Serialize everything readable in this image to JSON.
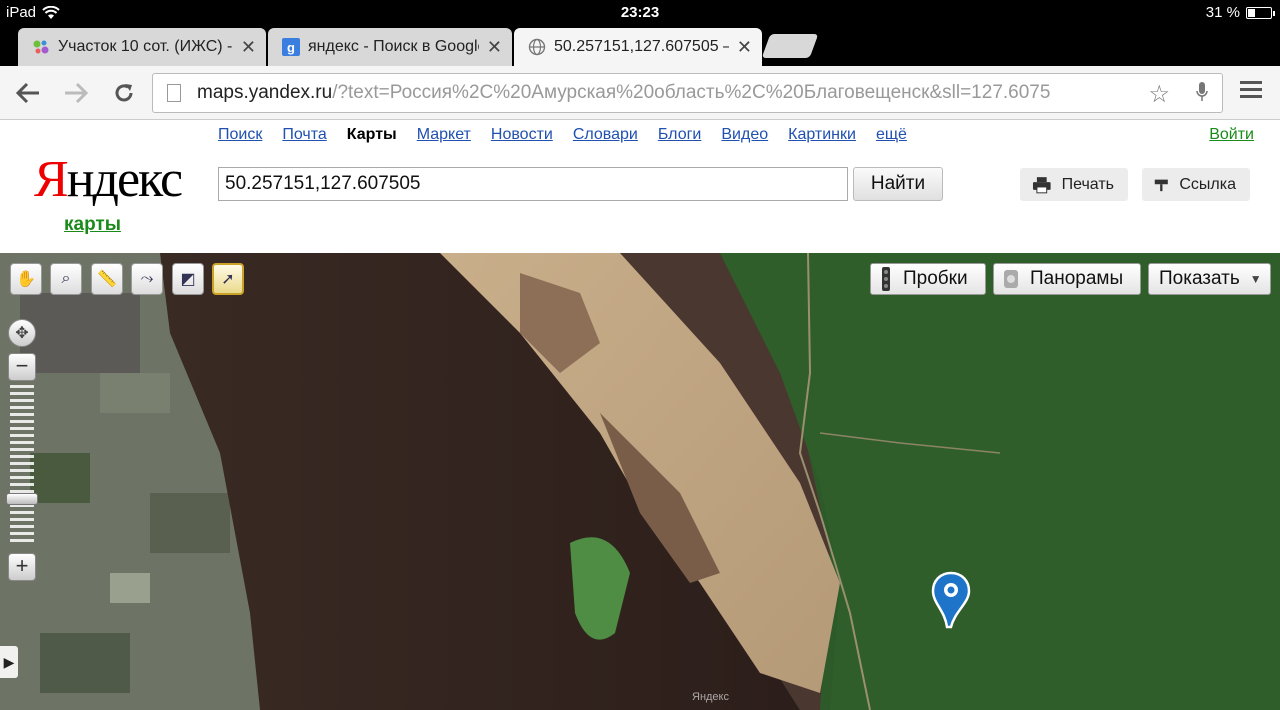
{
  "status_bar": {
    "device": "iPad",
    "time": "23:23",
    "battery": "31 %",
    "battery_level": 0.31
  },
  "tabs": [
    {
      "title": "Участок 10 сот. (ИЖС) - :",
      "favicon": "avito-icon",
      "active": false
    },
    {
      "title": "яндекс - Поиск в Google",
      "favicon": "google-icon",
      "active": false
    },
    {
      "title": "50.257151,127.607505 —",
      "favicon": "globe-icon",
      "active": true
    }
  ],
  "address_bar": {
    "host": "maps.yandex.ru",
    "path": "/?text=Россия%2C%20Амурская%20область%2C%20Благовещенск&sll=127.6075"
  },
  "yandex": {
    "nav": [
      "Поиск",
      "Почта",
      "Карты",
      "Маркет",
      "Новости",
      "Словари",
      "Блоги",
      "Видео",
      "Картинки",
      "ещё"
    ],
    "nav_current": "Карты",
    "login": "Войти",
    "logo_first": "Я",
    "logo_rest": "ндекс",
    "service": "карты",
    "search_value": "50.257151,127.607505",
    "search_button": "Найти",
    "print_button": "Печать",
    "link_button": "Ссылка"
  },
  "map": {
    "tools": [
      "hand-icon",
      "zoom-rect-icon",
      "ruler-icon",
      "route-icon",
      "layers-select-icon",
      "info-pointer-icon"
    ],
    "active_tool": "info-pointer-icon",
    "traffic_button": "Пробки",
    "panorama_button": "Панорамы",
    "show_button": "Показать",
    "copyright": "Яндекс",
    "zoom_level_fraction": 0.72
  },
  "colors": {
    "yandex_red": "#e00000",
    "link_blue": "#2050b0",
    "login_green": "#1a8a1a",
    "placemark_blue": "#1e74c8"
  }
}
